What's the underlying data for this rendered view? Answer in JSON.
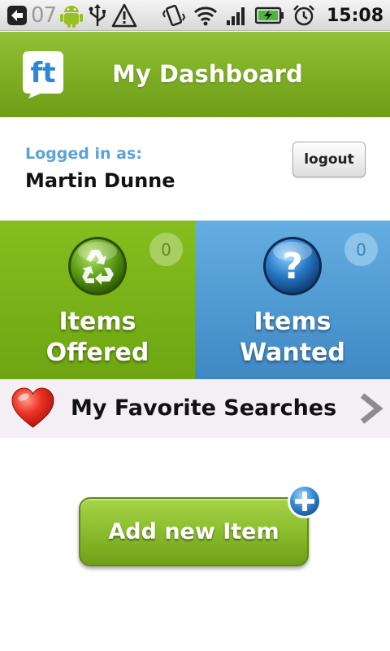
{
  "status_bar": {
    "notification_count": "07",
    "time": "15:08",
    "icons": [
      "back-arrow-icon",
      "android-icon",
      "usb-icon",
      "warning-icon",
      "vibrate-icon",
      "wifi-icon",
      "signal-icon",
      "battery-charging-icon",
      "alarm-clock-icon"
    ]
  },
  "header": {
    "title": "My Dashboard",
    "logo_text": "ft"
  },
  "account": {
    "logged_in_label": "Logged in as:",
    "user_name": "Martin Dunne",
    "logout_label": "logout"
  },
  "tiles": [
    {
      "label_line1": "Items",
      "label_line2": "Offered",
      "count": "0",
      "icon": "recycle-icon"
    },
    {
      "label_line1": "Items",
      "label_line2": "Wanted",
      "count": "0",
      "icon": "question-icon"
    }
  ],
  "favorites": {
    "label": "My Favorite Searches",
    "icon": "heart-icon"
  },
  "add_item": {
    "label": "Add new Item"
  },
  "colors": {
    "brand_green": "#7fb026",
    "brand_blue": "#4a94cf",
    "logged_label_blue": "#5aa3d8",
    "favorites_bg": "#f3eff5"
  }
}
